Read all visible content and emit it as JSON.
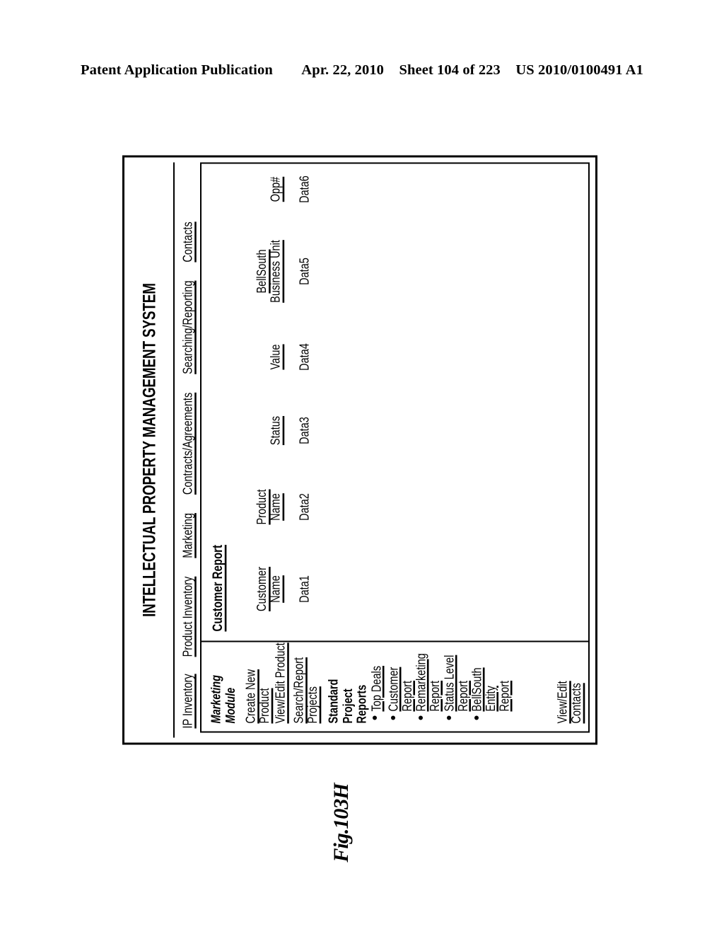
{
  "page_header": {
    "publication": "Patent Application Publication",
    "date": "Apr. 22, 2010",
    "sheet": "Sheet 104 of 223",
    "patent_number": "US 2010/0100491 A1"
  },
  "figure": {
    "caption": "Fig.103H"
  },
  "app": {
    "title": "INTELLECTUAL PROPERTY MANAGEMENT SYSTEM",
    "nav": [
      {
        "label": "IP Inventory"
      },
      {
        "label": "Product Inventory"
      },
      {
        "label": "Marketing"
      },
      {
        "label": "Contracts/Agreements"
      },
      {
        "label": "Searching/Reporting"
      },
      {
        "label": "Contacts"
      }
    ],
    "sidebar": {
      "module_title": "Marketing\nModule",
      "links": [
        {
          "label": "Create New Product"
        },
        {
          "label": "View/Edit Product"
        },
        {
          "label": "Search/Report\nProjects"
        }
      ],
      "section_heading": "Standard Project\nReports",
      "reports": [
        {
          "label": "Top Deals"
        },
        {
          "label": "Customer\nReport"
        },
        {
          "label": "Remarketing\nReport"
        },
        {
          "label": "Status Level\nReport"
        },
        {
          "label": "BellSouth\nEntity\nReport"
        }
      ],
      "footer_link": {
        "label": "View/Edit Contacts"
      }
    },
    "content": {
      "title": "Customer Report",
      "table": {
        "columns": [
          "Customer\nName",
          "Product\nName",
          "Status",
          "Value",
          "BellSouth\nBusiness Unit",
          "Opp#"
        ],
        "rows": [
          [
            "Data1",
            "Data2",
            "Data3",
            "Data4",
            "Data5",
            "Data6"
          ]
        ]
      }
    }
  }
}
